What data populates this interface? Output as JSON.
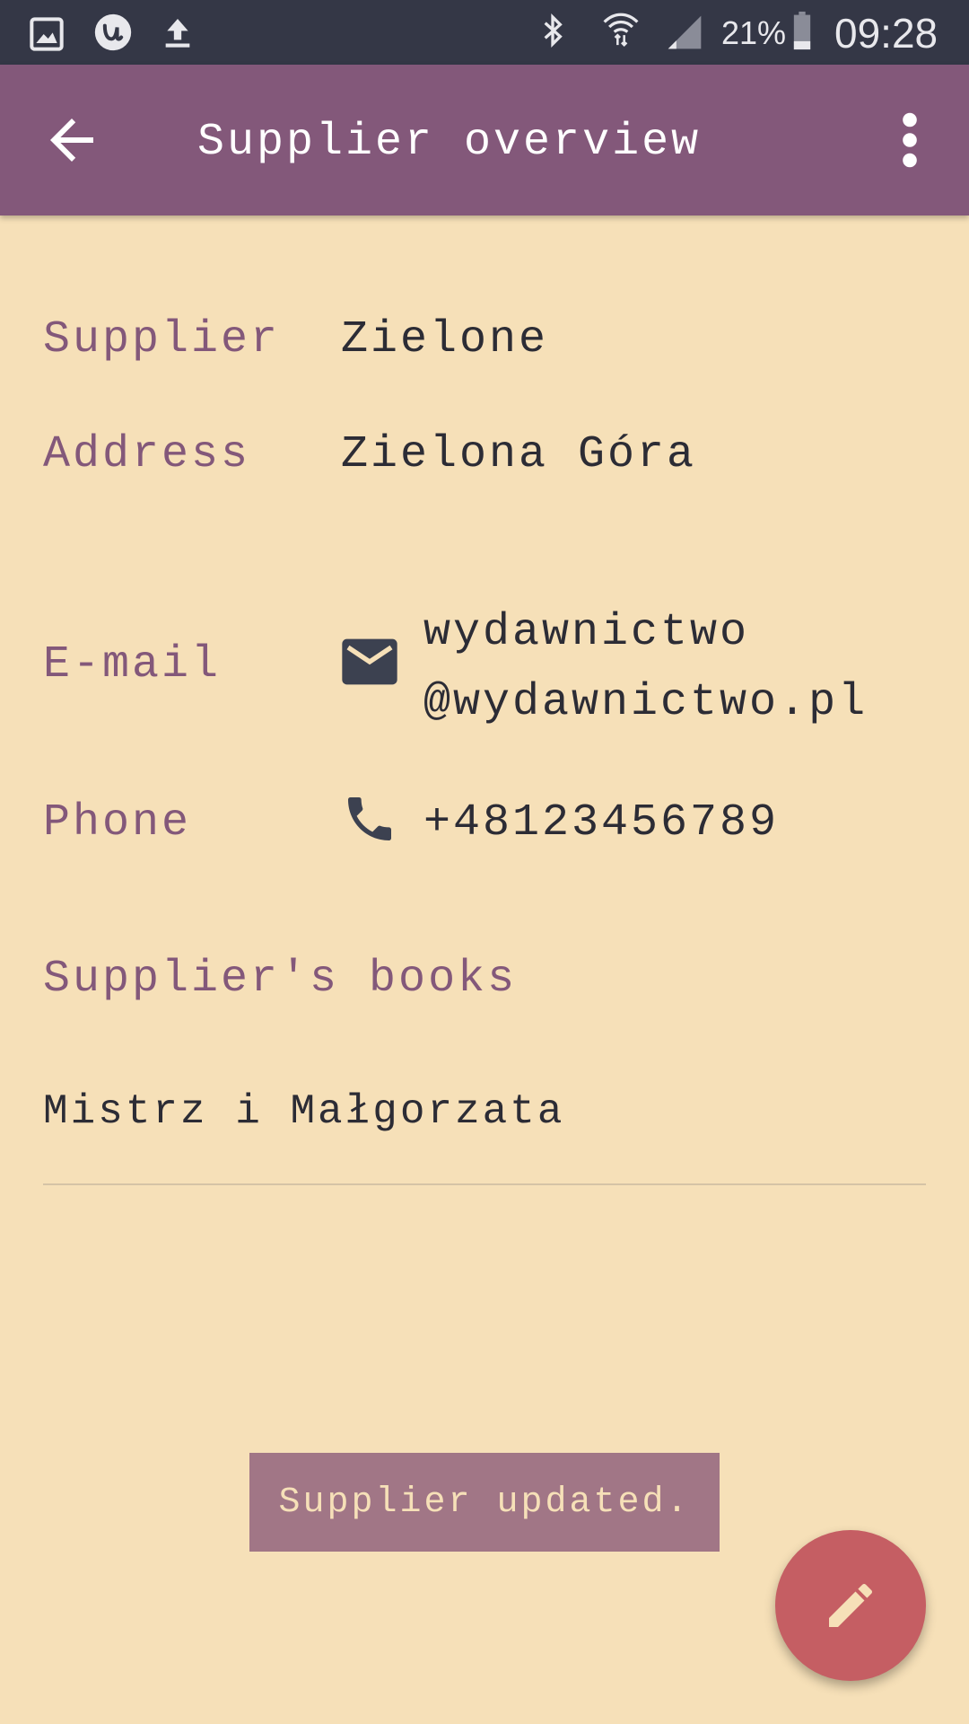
{
  "status_bar": {
    "left_icons": [
      "gallery-icon",
      "u-app-icon",
      "upload-icon"
    ],
    "right_icons": [
      "bluetooth-icon",
      "wifi-icon",
      "signal-icon",
      "battery-icon"
    ],
    "battery": "21%",
    "time": "09:28"
  },
  "app_bar": {
    "title": "Supplier overview",
    "back_icon": "arrow-back-icon",
    "menu_icon": "more-vert-icon"
  },
  "details": {
    "supplier_label": "Supplier",
    "supplier_value": "Zielone",
    "address_label": "Address",
    "address_value": "Zielona Góra",
    "email_label": "E-mail",
    "email_line1": "wydawnictwo",
    "email_line2": "@wydawnictwo.pl",
    "phone_label": "Phone",
    "phone_value": "+48123456789"
  },
  "books": {
    "header": "Supplier's books",
    "items": [
      "Mistrz i Małgorzata"
    ]
  },
  "snackbar": {
    "message": "Supplier updated."
  },
  "fab": {
    "icon": "edit-icon"
  },
  "colors": {
    "background": "#f6e0b8",
    "primary": "#83587a",
    "status_bar": "#343746",
    "text": "#2c2c35",
    "fab": "#c55e63",
    "snackbar": "#a17686"
  }
}
